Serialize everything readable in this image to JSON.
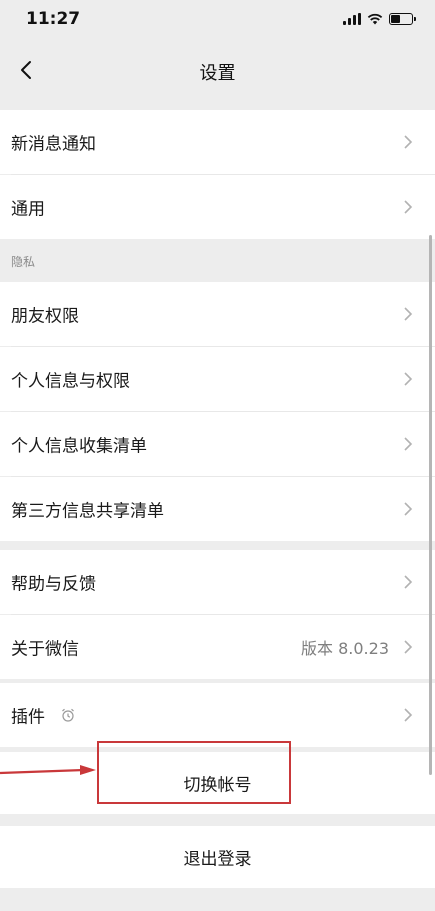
{
  "status_bar": {
    "time": "11:27"
  },
  "nav": {
    "title": "设置"
  },
  "groups": {
    "notifications": {
      "label": "新消息通知"
    },
    "general": {
      "label": "通用"
    },
    "privacy_header": "隐私",
    "friend_permissions": {
      "label": "朋友权限"
    },
    "personal_info": {
      "label": "个人信息与权限"
    },
    "info_collection": {
      "label": "个人信息收集清单"
    },
    "third_party": {
      "label": "第三方信息共享清单"
    },
    "help": {
      "label": "帮助与反馈"
    },
    "about": {
      "label": "关于微信",
      "value": "版本 8.0.23"
    },
    "plugins": {
      "label": "插件"
    }
  },
  "actions": {
    "switch_account": "切换帐号",
    "logout": "退出登录"
  },
  "colors": {
    "background": "#ededed",
    "row": "#ffffff",
    "annotation": "#c9383a"
  },
  "icons": {
    "back": "chevron-left-icon",
    "row": "chevron-right-icon",
    "plugin": "alarm-clock-icon"
  }
}
